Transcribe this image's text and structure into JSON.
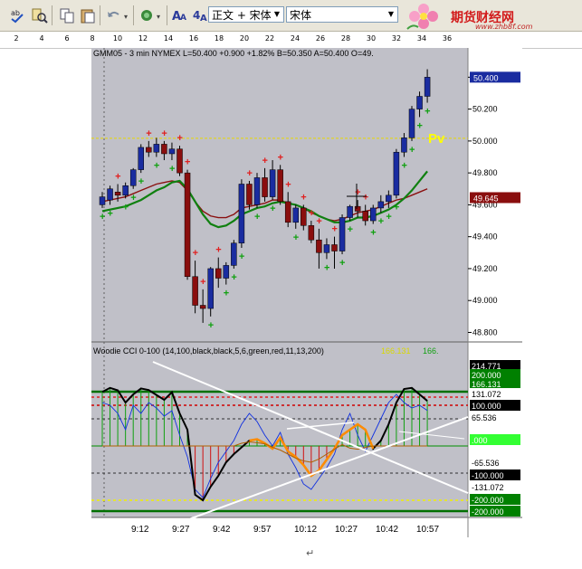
{
  "toolbar": {
    "style_value": "正文 + 宋体",
    "font_value": "宋体",
    "brand_text": "期货财经网",
    "brand_url": "www.zhb8f.com"
  },
  "ruler": {
    "ticks": [
      "2",
      "4",
      "6",
      "8",
      "10",
      "12",
      "14",
      "16",
      "18",
      "20",
      "22",
      "24",
      "26",
      "28",
      "30",
      "32",
      "34",
      "36"
    ]
  },
  "price_panel": {
    "header": "GMM05 - 3 min  NYMEX  L=50.400  +0.900  +1.82%  B=50.350  A=50.400  O=49.",
    "pv_label": "Pv",
    "y_ticks": [
      "50.400",
      "50.200",
      "50.000",
      "49.800",
      "49.600",
      "49.400",
      "49.200",
      "49.000",
      "48.800"
    ],
    "tag_last": "50.400",
    "tag_ma": "49.645"
  },
  "cci_panel": {
    "header": "Woodie CCI 0-100  (14,100,black,black,5,6,green,red,11,13,200)",
    "header_val1": "166.131",
    "header_val2": "166.",
    "tags": [
      {
        "text": "214.771",
        "bg": "#000000",
        "fg": "#ffffff"
      },
      {
        "text": "200.000",
        "bg": "#008000",
        "fg": "#ffffff"
      },
      {
        "text": "166.131",
        "bg": "#008000",
        "fg": "#ffffff"
      },
      {
        "text": "131.072",
        "bg": "#ffffff",
        "fg": "#000000"
      },
      {
        "text": "100.000",
        "bg": "#000000",
        "fg": "#ffffff"
      },
      {
        "text": "65.536",
        "bg": "#ffffff",
        "fg": "#000000"
      },
      {
        "text": ".000",
        "bg": "#33ff33",
        "fg": "#ffffff"
      },
      {
        "text": "-65.536",
        "bg": "#ffffff",
        "fg": "#000000"
      },
      {
        "text": "-100.000",
        "bg": "#000000",
        "fg": "#ffffff"
      },
      {
        "text": "-131.072",
        "bg": "#ffffff",
        "fg": "#000000"
      },
      {
        "text": "-200.000",
        "bg": "#008000",
        "fg": "#ffffff"
      },
      {
        "text": "-200.000",
        "bg": "#008000",
        "fg": "#ffffff"
      }
    ],
    "time_labels": [
      "9:12",
      "9:27",
      "9:42",
      "9:57",
      "10:12",
      "10:27",
      "10:42",
      "10:57"
    ]
  },
  "colors": {
    "panel_bg": "#c0c0c8",
    "bull": "#1a2ca0",
    "bear": "#8a0e0e",
    "accent_yellow": "#ffff00"
  },
  "chart_data": {
    "type": "candlestick",
    "instrument": "GMM05",
    "interval": "3 min",
    "ylim": [
      48.78,
      50.47
    ],
    "candles": [
      {
        "o": 49.6,
        "h": 49.68,
        "l": 49.58,
        "c": 49.65
      },
      {
        "o": 49.63,
        "h": 49.72,
        "l": 49.6,
        "c": 49.7
      },
      {
        "o": 49.68,
        "h": 49.73,
        "l": 49.62,
        "c": 49.66
      },
      {
        "o": 49.66,
        "h": 49.74,
        "l": 49.64,
        "c": 49.72
      },
      {
        "o": 49.72,
        "h": 49.83,
        "l": 49.7,
        "c": 49.82
      },
      {
        "o": 49.82,
        "h": 49.98,
        "l": 49.8,
        "c": 49.96
      },
      {
        "o": 49.96,
        "h": 50.0,
        "l": 49.9,
        "c": 49.93
      },
      {
        "o": 49.93,
        "h": 50.02,
        "l": 49.9,
        "c": 49.98
      },
      {
        "o": 49.98,
        "h": 50.0,
        "l": 49.88,
        "c": 49.92
      },
      {
        "o": 49.92,
        "h": 49.99,
        "l": 49.88,
        "c": 49.95
      },
      {
        "o": 49.95,
        "h": 49.97,
        "l": 49.78,
        "c": 49.8
      },
      {
        "o": 49.8,
        "h": 49.82,
        "l": 49.13,
        "c": 49.15
      },
      {
        "o": 49.15,
        "h": 49.25,
        "l": 48.92,
        "c": 48.97
      },
      {
        "o": 48.97,
        "h": 49.07,
        "l": 48.86,
        "c": 48.95
      },
      {
        "o": 48.95,
        "h": 49.21,
        "l": 48.9,
        "c": 49.2
      },
      {
        "o": 49.2,
        "h": 49.27,
        "l": 49.08,
        "c": 49.14
      },
      {
        "o": 49.14,
        "h": 49.24,
        "l": 49.1,
        "c": 49.22
      },
      {
        "o": 49.22,
        "h": 49.38,
        "l": 49.2,
        "c": 49.36
      },
      {
        "o": 49.36,
        "h": 49.76,
        "l": 49.33,
        "c": 49.73
      },
      {
        "o": 49.73,
        "h": 49.75,
        "l": 49.57,
        "c": 49.6
      },
      {
        "o": 49.6,
        "h": 49.8,
        "l": 49.58,
        "c": 49.77
      },
      {
        "o": 49.77,
        "h": 49.83,
        "l": 49.62,
        "c": 49.65
      },
      {
        "o": 49.65,
        "h": 49.88,
        "l": 49.63,
        "c": 49.82
      },
      {
        "o": 49.82,
        "h": 49.85,
        "l": 49.6,
        "c": 49.62
      },
      {
        "o": 49.62,
        "h": 49.68,
        "l": 49.46,
        "c": 49.49
      },
      {
        "o": 49.49,
        "h": 49.6,
        "l": 49.45,
        "c": 49.58
      },
      {
        "o": 49.58,
        "h": 49.6,
        "l": 49.44,
        "c": 49.47
      },
      {
        "o": 49.47,
        "h": 49.5,
        "l": 49.36,
        "c": 49.38
      },
      {
        "o": 49.38,
        "h": 49.45,
        "l": 49.2,
        "c": 49.3
      },
      {
        "o": 49.3,
        "h": 49.39,
        "l": 49.26,
        "c": 49.35
      },
      {
        "o": 49.35,
        "h": 49.4,
        "l": 49.2,
        "c": 49.31
      },
      {
        "o": 49.31,
        "h": 49.54,
        "l": 49.29,
        "c": 49.52
      },
      {
        "o": 49.52,
        "h": 49.6,
        "l": 49.5,
        "c": 49.59
      },
      {
        "o": 49.59,
        "h": 49.63,
        "l": 49.52,
        "c": 49.56
      },
      {
        "o": 49.56,
        "h": 49.6,
        "l": 49.47,
        "c": 49.5
      },
      {
        "o": 49.5,
        "h": 49.6,
        "l": 49.48,
        "c": 49.58
      },
      {
        "o": 49.58,
        "h": 49.66,
        "l": 49.55,
        "c": 49.62
      },
      {
        "o": 49.62,
        "h": 49.69,
        "l": 49.58,
        "c": 49.66
      },
      {
        "o": 49.66,
        "h": 49.95,
        "l": 49.64,
        "c": 49.93
      },
      {
        "o": 49.93,
        "h": 50.05,
        "l": 49.9,
        "c": 50.02
      },
      {
        "o": 50.02,
        "h": 50.22,
        "l": 50.0,
        "c": 50.2
      },
      {
        "o": 50.2,
        "h": 50.31,
        "l": 50.15,
        "c": 50.28
      },
      {
        "o": 50.28,
        "h": 50.45,
        "l": 50.24,
        "c": 50.4
      }
    ],
    "ma_green": [
      49.56,
      49.57,
      49.58,
      49.59,
      49.61,
      49.63,
      49.66,
      49.69,
      49.71,
      49.74,
      49.75,
      49.7,
      49.62,
      49.54,
      49.48,
      49.46,
      49.47,
      49.5,
      49.54,
      49.56,
      49.58,
      49.59,
      49.61,
      49.62,
      49.61,
      49.6,
      49.58,
      49.56,
      49.53,
      49.51,
      49.49,
      49.49,
      49.5,
      49.52,
      49.52,
      49.53,
      49.55,
      49.57,
      49.6,
      49.64,
      49.69,
      49.75,
      49.81
    ],
    "ma_red": [
      49.62,
      49.63,
      49.64,
      49.65,
      49.67,
      49.69,
      49.71,
      49.73,
      49.74,
      49.75,
      49.74,
      49.69,
      49.62,
      49.56,
      49.53,
      49.52,
      49.52,
      49.54,
      49.58,
      49.59,
      49.6,
      49.61,
      49.63,
      49.63,
      49.61,
      49.6,
      49.58,
      49.55,
      49.53,
      49.51,
      49.5,
      49.51,
      49.53,
      49.55,
      49.56,
      49.57,
      49.59,
      49.61,
      49.63,
      49.64,
      49.66,
      49.68,
      49.7
    ],
    "cci": [
      199,
      214,
      205,
      160,
      190,
      212,
      206,
      188,
      170,
      198,
      120,
      60,
      -180,
      -200,
      -150,
      -110,
      -60,
      -30,
      -5,
      20,
      25,
      10,
      -10,
      30,
      -20,
      -40,
      -70,
      -110,
      -90,
      -50,
      -10,
      40,
      60,
      80,
      60,
      -10,
      20,
      80,
      160,
      210,
      214,
      190,
      166
    ],
    "cci_fast": [
      160,
      150,
      120,
      60,
      150,
      120,
      160,
      140,
      110,
      130,
      40,
      -40,
      -160,
      -190,
      -120,
      -60,
      -20,
      20,
      80,
      120,
      90,
      40,
      0,
      50,
      -30,
      -80,
      -140,
      -160,
      -120,
      -80,
      -30,
      60,
      120,
      40,
      -20,
      40,
      100,
      160,
      190,
      160,
      140,
      150,
      131
    ],
    "sidewinder": [
      0,
      0,
      0,
      0,
      0,
      0,
      0,
      0,
      0,
      0,
      0,
      0,
      0,
      0,
      0,
      0,
      0,
      0,
      10,
      15,
      12,
      8,
      -5,
      -15,
      -30,
      -45,
      -55,
      -60,
      -48,
      -30,
      -12,
      5,
      -8,
      -12,
      -5,
      0,
      0,
      0,
      0,
      0,
      0,
      0,
      0
    ]
  }
}
